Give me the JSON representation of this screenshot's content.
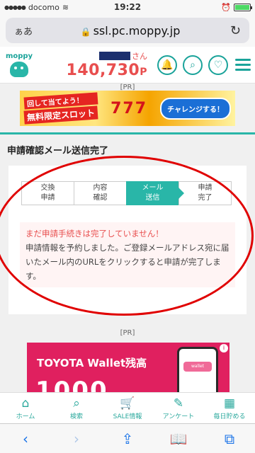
{
  "status_bar": {
    "carrier": "docomo",
    "time": "19:22",
    "signal_icon": "signal-icon",
    "wifi_icon": "wifi-icon",
    "battery_level": 1.0
  },
  "address_bar": {
    "aa_label": "ぁあ",
    "url": "ssl.pc.moppy.jp",
    "lock_icon": "🔒",
    "reload_icon": "↻"
  },
  "header": {
    "logo_text": "moppy",
    "user_suffix": "さん",
    "points": "140,730",
    "points_unit": "P",
    "bell_icon": "🔔",
    "search_icon": "⌕",
    "heart_icon": "♡"
  },
  "pr_label_top": "[PR]",
  "top_banner": {
    "line1": "回して当てよう！",
    "line2": "無料限定スロット",
    "slots": "777",
    "cta": "チャレンジする！"
  },
  "section_title": "申請確認メール送信完了",
  "steps": [
    {
      "label": "交換\n申請",
      "active": false
    },
    {
      "label": "内容\n確認",
      "active": false
    },
    {
      "label": "メール\n送信",
      "active": true
    },
    {
      "label": "申請\n完了",
      "active": false
    }
  ],
  "notice": {
    "warning": "まだ申請手続きは完了していません！",
    "body": "申請情報を予約しました。ご登録メールアドレス宛に届いたメール内のURLをクリックすると申請が完了します。"
  },
  "pr_label_bottom": "[PR]",
  "bottom_banner": {
    "text": "TOYOTA Wallet残高",
    "big": "1000",
    "phone_label": "wallet",
    "info_icon": "i"
  },
  "site_nav": [
    {
      "icon": "⌂",
      "label": "ホーム",
      "icon_name": "home-icon"
    },
    {
      "icon": "⌕",
      "label": "検索",
      "icon_name": "search-icon"
    },
    {
      "icon": "🛒",
      "label": "SALE情報",
      "icon_name": "cart-icon"
    },
    {
      "icon": "✎",
      "label": "アンケート",
      "icon_name": "survey-icon"
    },
    {
      "icon": "▦",
      "label": "毎日貯める",
      "icon_name": "daily-icon"
    }
  ],
  "safari_toolbar": {
    "back_icon": "‹",
    "forward_icon": "›",
    "share_icon": "⇪",
    "bookmarks_icon": "📖",
    "tabs_icon": "⧉"
  }
}
